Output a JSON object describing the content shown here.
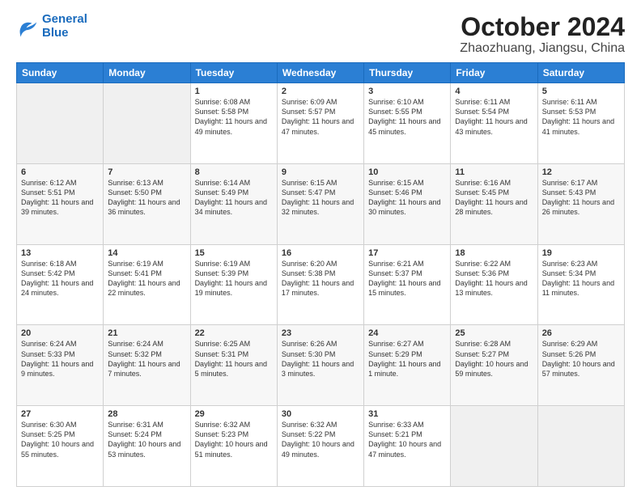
{
  "logo": {
    "line1": "General",
    "line2": "Blue"
  },
  "title": "October 2024",
  "subtitle": "Zhaozhuang, Jiangsu, China",
  "headers": [
    "Sunday",
    "Monday",
    "Tuesday",
    "Wednesday",
    "Thursday",
    "Friday",
    "Saturday"
  ],
  "weeks": [
    [
      {
        "day": "",
        "content": ""
      },
      {
        "day": "",
        "content": ""
      },
      {
        "day": "1",
        "content": "Sunrise: 6:08 AM\nSunset: 5:58 PM\nDaylight: 11 hours and 49 minutes."
      },
      {
        "day": "2",
        "content": "Sunrise: 6:09 AM\nSunset: 5:57 PM\nDaylight: 11 hours and 47 minutes."
      },
      {
        "day": "3",
        "content": "Sunrise: 6:10 AM\nSunset: 5:55 PM\nDaylight: 11 hours and 45 minutes."
      },
      {
        "day": "4",
        "content": "Sunrise: 6:11 AM\nSunset: 5:54 PM\nDaylight: 11 hours and 43 minutes."
      },
      {
        "day": "5",
        "content": "Sunrise: 6:11 AM\nSunset: 5:53 PM\nDaylight: 11 hours and 41 minutes."
      }
    ],
    [
      {
        "day": "6",
        "content": "Sunrise: 6:12 AM\nSunset: 5:51 PM\nDaylight: 11 hours and 39 minutes."
      },
      {
        "day": "7",
        "content": "Sunrise: 6:13 AM\nSunset: 5:50 PM\nDaylight: 11 hours and 36 minutes."
      },
      {
        "day": "8",
        "content": "Sunrise: 6:14 AM\nSunset: 5:49 PM\nDaylight: 11 hours and 34 minutes."
      },
      {
        "day": "9",
        "content": "Sunrise: 6:15 AM\nSunset: 5:47 PM\nDaylight: 11 hours and 32 minutes."
      },
      {
        "day": "10",
        "content": "Sunrise: 6:15 AM\nSunset: 5:46 PM\nDaylight: 11 hours and 30 minutes."
      },
      {
        "day": "11",
        "content": "Sunrise: 6:16 AM\nSunset: 5:45 PM\nDaylight: 11 hours and 28 minutes."
      },
      {
        "day": "12",
        "content": "Sunrise: 6:17 AM\nSunset: 5:43 PM\nDaylight: 11 hours and 26 minutes."
      }
    ],
    [
      {
        "day": "13",
        "content": "Sunrise: 6:18 AM\nSunset: 5:42 PM\nDaylight: 11 hours and 24 minutes."
      },
      {
        "day": "14",
        "content": "Sunrise: 6:19 AM\nSunset: 5:41 PM\nDaylight: 11 hours and 22 minutes."
      },
      {
        "day": "15",
        "content": "Sunrise: 6:19 AM\nSunset: 5:39 PM\nDaylight: 11 hours and 19 minutes."
      },
      {
        "day": "16",
        "content": "Sunrise: 6:20 AM\nSunset: 5:38 PM\nDaylight: 11 hours and 17 minutes."
      },
      {
        "day": "17",
        "content": "Sunrise: 6:21 AM\nSunset: 5:37 PM\nDaylight: 11 hours and 15 minutes."
      },
      {
        "day": "18",
        "content": "Sunrise: 6:22 AM\nSunset: 5:36 PM\nDaylight: 11 hours and 13 minutes."
      },
      {
        "day": "19",
        "content": "Sunrise: 6:23 AM\nSunset: 5:34 PM\nDaylight: 11 hours and 11 minutes."
      }
    ],
    [
      {
        "day": "20",
        "content": "Sunrise: 6:24 AM\nSunset: 5:33 PM\nDaylight: 11 hours and 9 minutes."
      },
      {
        "day": "21",
        "content": "Sunrise: 6:24 AM\nSunset: 5:32 PM\nDaylight: 11 hours and 7 minutes."
      },
      {
        "day": "22",
        "content": "Sunrise: 6:25 AM\nSunset: 5:31 PM\nDaylight: 11 hours and 5 minutes."
      },
      {
        "day": "23",
        "content": "Sunrise: 6:26 AM\nSunset: 5:30 PM\nDaylight: 11 hours and 3 minutes."
      },
      {
        "day": "24",
        "content": "Sunrise: 6:27 AM\nSunset: 5:29 PM\nDaylight: 11 hours and 1 minute."
      },
      {
        "day": "25",
        "content": "Sunrise: 6:28 AM\nSunset: 5:27 PM\nDaylight: 10 hours and 59 minutes."
      },
      {
        "day": "26",
        "content": "Sunrise: 6:29 AM\nSunset: 5:26 PM\nDaylight: 10 hours and 57 minutes."
      }
    ],
    [
      {
        "day": "27",
        "content": "Sunrise: 6:30 AM\nSunset: 5:25 PM\nDaylight: 10 hours and 55 minutes."
      },
      {
        "day": "28",
        "content": "Sunrise: 6:31 AM\nSunset: 5:24 PM\nDaylight: 10 hours and 53 minutes."
      },
      {
        "day": "29",
        "content": "Sunrise: 6:32 AM\nSunset: 5:23 PM\nDaylight: 10 hours and 51 minutes."
      },
      {
        "day": "30",
        "content": "Sunrise: 6:32 AM\nSunset: 5:22 PM\nDaylight: 10 hours and 49 minutes."
      },
      {
        "day": "31",
        "content": "Sunrise: 6:33 AM\nSunset: 5:21 PM\nDaylight: 10 hours and 47 minutes."
      },
      {
        "day": "",
        "content": ""
      },
      {
        "day": "",
        "content": ""
      }
    ]
  ]
}
